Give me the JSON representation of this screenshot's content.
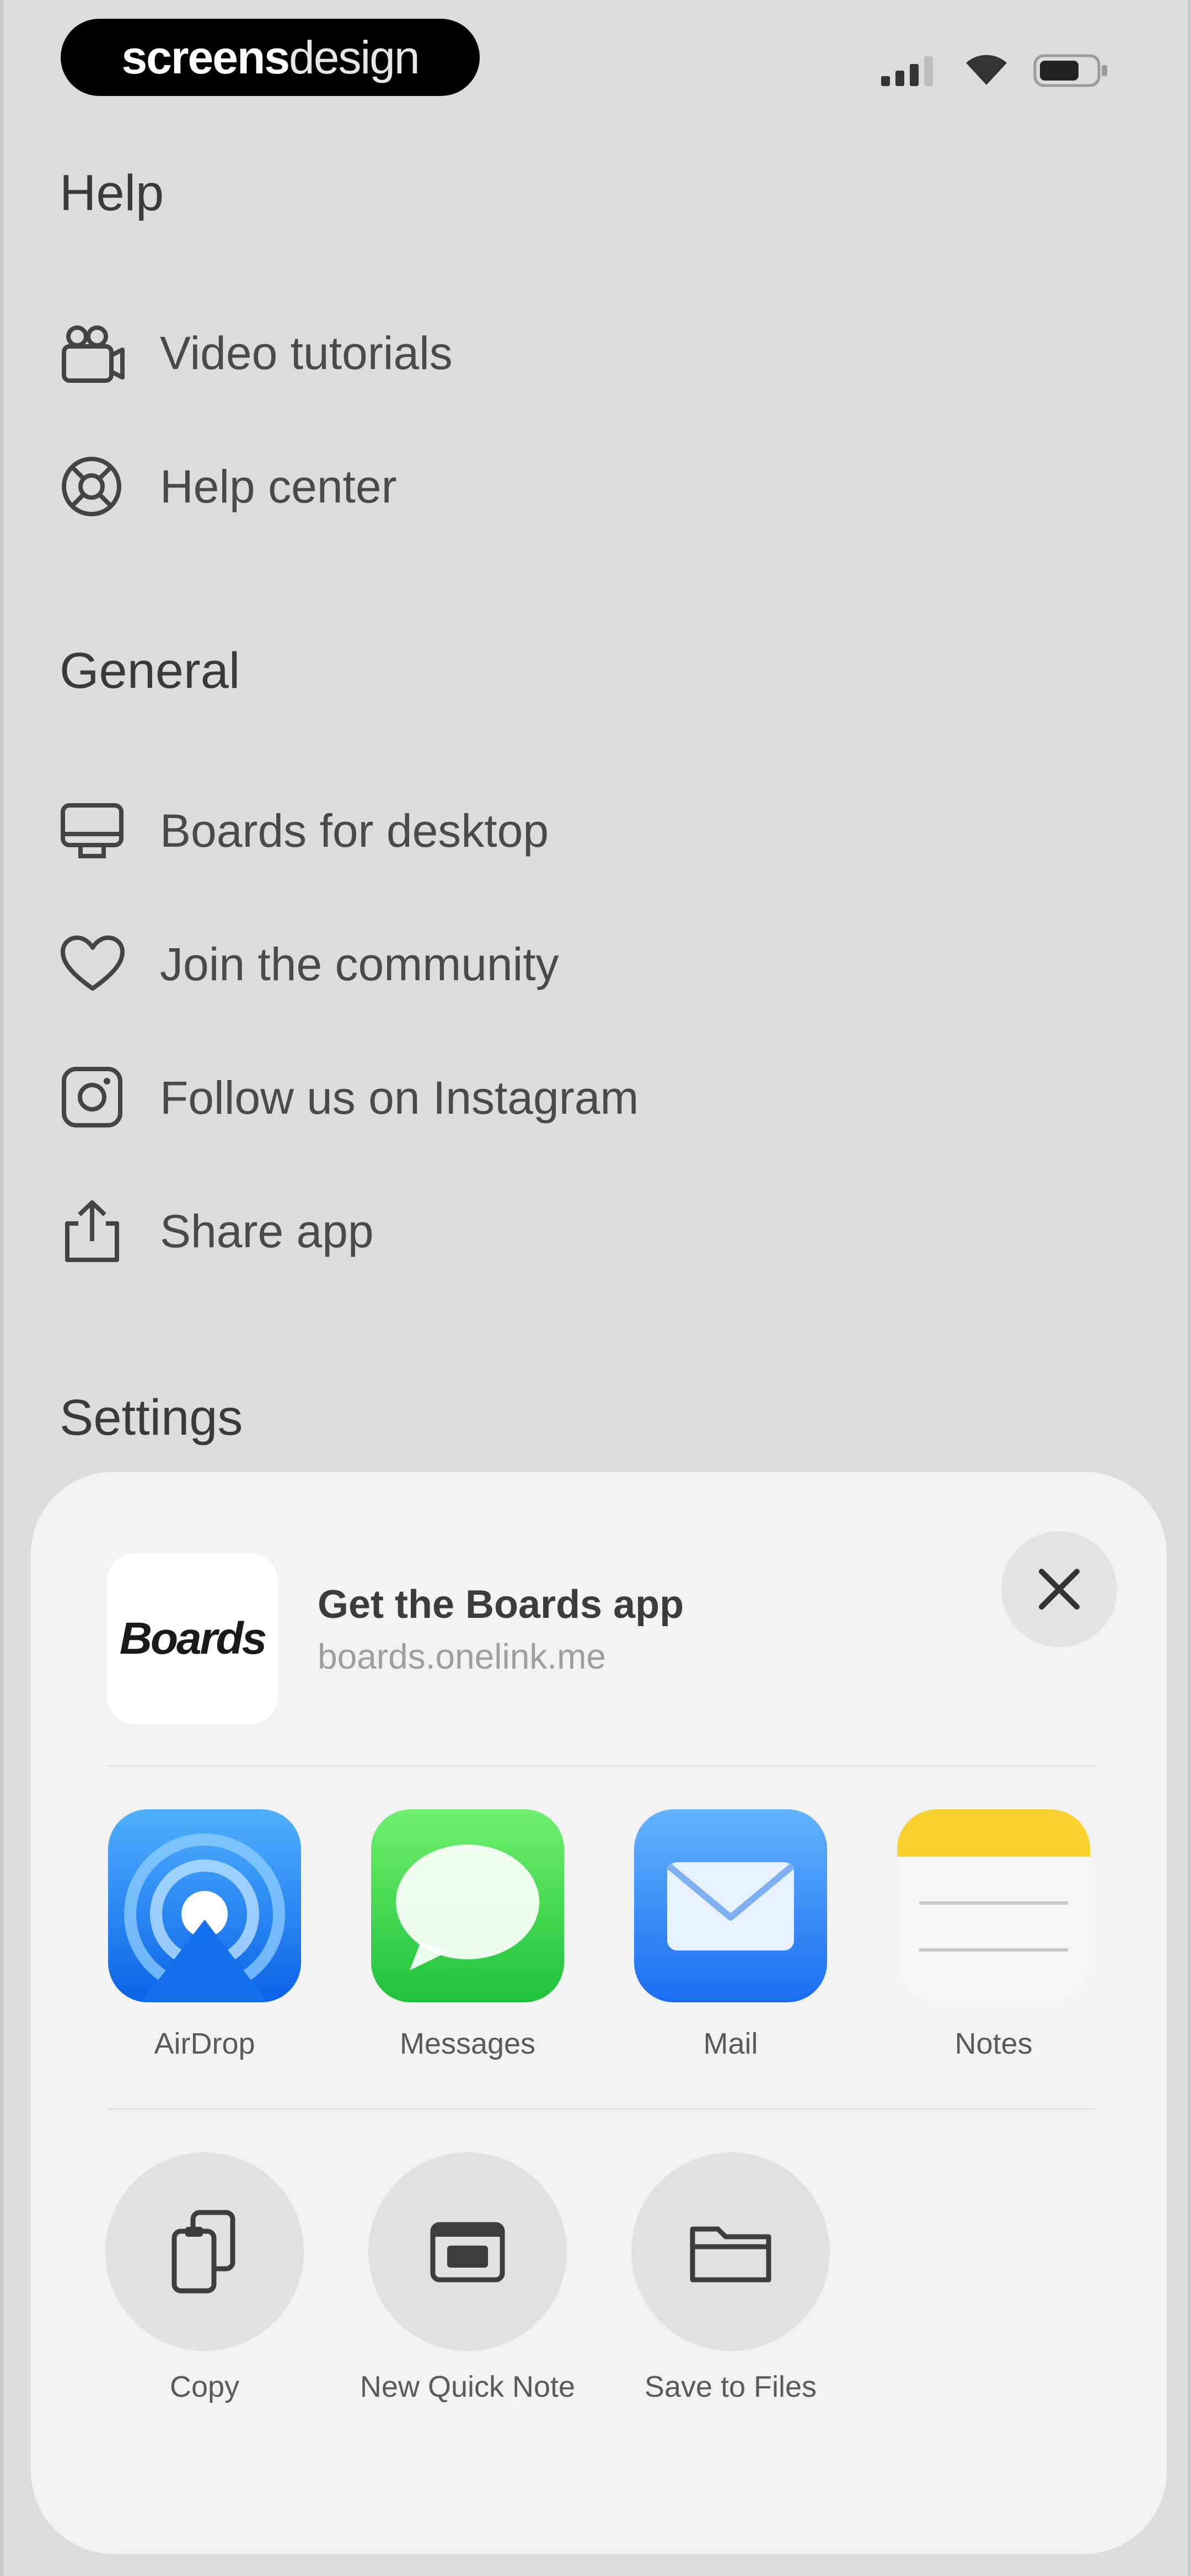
{
  "status_bar": {
    "brand_bold": "screens",
    "brand_light": "design"
  },
  "help": {
    "title": "Help",
    "items": [
      {
        "label": "Video tutorials",
        "icon": "video-tutorials-icon"
      },
      {
        "label": "Help center",
        "icon": "lifebuoy-icon"
      }
    ]
  },
  "general": {
    "title": "General",
    "items": [
      {
        "label": "Boards for desktop",
        "icon": "desktop-icon"
      },
      {
        "label": "Join the community",
        "icon": "heart-icon"
      },
      {
        "label": "Follow us on Instagram",
        "icon": "instagram-icon"
      },
      {
        "label": "Share app",
        "icon": "share-icon"
      }
    ]
  },
  "settings": {
    "title": "Settings"
  },
  "share_sheet": {
    "thumb_text": "Boards",
    "title": "Get the Boards app",
    "subtitle": "boards.onelink.me",
    "apps": [
      {
        "label": "AirDrop",
        "icon": "airdrop-icon"
      },
      {
        "label": "Messages",
        "icon": "messages-icon"
      },
      {
        "label": "Mail",
        "icon": "mail-icon"
      },
      {
        "label": "Notes",
        "icon": "notes-icon"
      }
    ],
    "actions": [
      {
        "label": "Copy",
        "icon": "copy-icon"
      },
      {
        "label": "New Quick Note",
        "icon": "quick-note-icon"
      },
      {
        "label": "Save to Files",
        "icon": "folder-icon"
      }
    ]
  },
  "colors": {
    "background": "#dcdcdc",
    "sheet": "#f2f2f2",
    "airdrop": "#1d7cf2",
    "messages": "#3fd14b",
    "mail": "#3f8ef5",
    "notes_yellow": "#f9d230"
  }
}
